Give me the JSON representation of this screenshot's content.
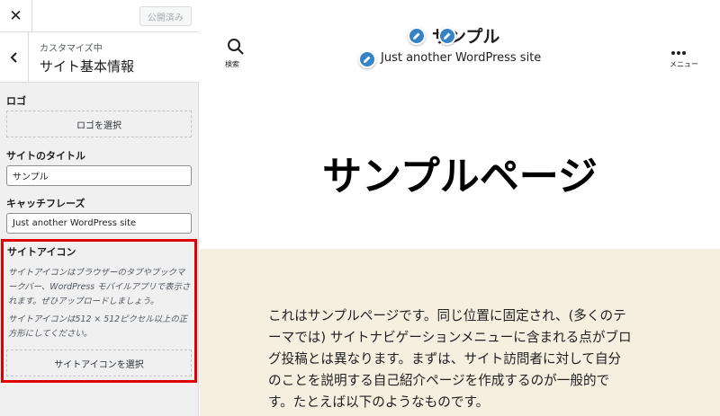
{
  "topbar": {
    "close_glyph": "✕",
    "publish_label": "公開済み"
  },
  "section": {
    "breadcrumb": "カスタマイズ中",
    "title": "サイト基本情報"
  },
  "logo": {
    "label": "ロゴ",
    "select_button": "ロゴを選択"
  },
  "site_title_field": {
    "label": "サイトのタイトル",
    "value": "サンプル"
  },
  "tagline_field": {
    "label": "キャッチフレーズ",
    "value": "Just another WordPress site"
  },
  "site_icon": {
    "label": "サイトアイコン",
    "description_1_line_1": "サイトアイコンはブラウザーのタブやブックマ",
    "description_1_line_2": "ークバー、WordPress モバイルアプリで表示さ",
    "description_1_line_3": "れます。ぜひアップロードしましょう。",
    "description_2_line_1": "サイトアイコンは512 × 512ピクセル以上の正",
    "description_2_line_2": "方形にしてください。",
    "select_button": "サイトアイコンを選択",
    "highlight_color": "#e00000"
  },
  "preview": {
    "search_label": "検索",
    "menu_label": "メニュー",
    "site_title": "サンプル",
    "tagline": "Just another WordPress site",
    "page_heading": "サンプルページ",
    "body_line_1": "これはサンプルページです。同じ位置に固定され、(多くのテ",
    "body_line_2": "ーマでは) サイトナビゲーションメニューに含まれる点がブロ",
    "body_line_3": "グ投稿とは異なります。まずは、サイト訪問者に対して自分",
    "body_line_4": "のことを説明する自己紹介ページを作成するのが一般的で",
    "body_line_5": "す。たとえば以下のようなものです。",
    "content_bg": "#f5efe0",
    "edit_shortcut_color": "#3582c4"
  }
}
